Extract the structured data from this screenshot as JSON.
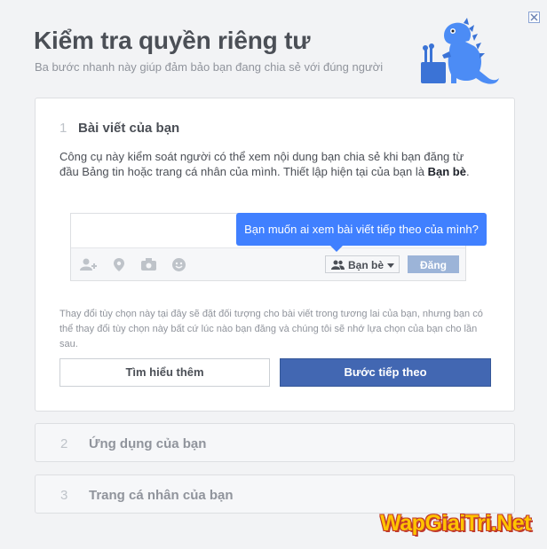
{
  "header": {
    "title": "Kiểm tra quyền riêng tư",
    "subtitle": "Ba bước nhanh này giúp đảm bảo bạn đang chia sẻ với đúng người"
  },
  "steps": [
    {
      "number": "1",
      "title": "Bài viết của bạn",
      "description_prefix": "Công cụ này kiểm soát người có thể xem nội dung bạn chia sẻ khi bạn đăng từ đầu Bảng tin hoặc trang cá nhân của mình. Thiết lập hiện tại của bạn là ",
      "description_value": "Bạn bè",
      "description_suffix": ".",
      "tooltip": "Bạn muốn ai xem bài viết tiếp theo của mình?",
      "audience_label": "Bạn bè",
      "post_label": "Đăng",
      "note": "Thay đổi tùy chọn này tại đây sẽ đặt đối tượng cho bài viết trong tương lai của bạn, nhưng bạn có thể thay đổi tùy chọn này bất cứ lúc nào bạn đăng và chúng tôi sẽ nhớ lựa chọn của bạn cho lần sau.",
      "learn_more_label": "Tìm hiểu thêm",
      "next_label": "Bước tiếp theo"
    },
    {
      "number": "2",
      "title": "Ứng dụng của bạn"
    },
    {
      "number": "3",
      "title": "Trang cá nhân của bạn"
    }
  ],
  "composer_icons": [
    "tag-friends-icon",
    "location-icon",
    "camera-icon",
    "feeling-icon"
  ],
  "watermark": "WapGiaiTri.Net",
  "colors": {
    "primary": "#4267b2",
    "tooltip": "#4080ff",
    "post_disabled": "#9cb4d8",
    "dino": "#4c8cf5"
  }
}
